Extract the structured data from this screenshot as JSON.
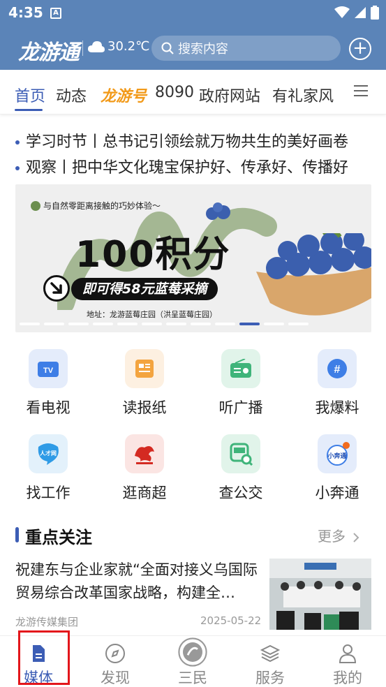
{
  "status_bar": {
    "time": "4:35",
    "notification_icon": "A"
  },
  "header": {
    "logo": "龙游通",
    "weather": {
      "icon": "cloud-icon",
      "temperature": "30.2℃"
    },
    "search": {
      "placeholder": "搜索内容"
    },
    "add_icon": "plus-icon"
  },
  "tabs": [
    {
      "label": "首页",
      "active": true
    },
    {
      "label": "动态"
    },
    {
      "label": "龙游号"
    },
    {
      "label": "8090"
    },
    {
      "label": "政府网站"
    },
    {
      "label": "有礼家风"
    }
  ],
  "headlines": [
    "学习时节丨总书记引领绘就万物共生的美好画卷",
    "观察丨把中华文化瑰宝保护好、传承好、传播好"
  ],
  "banner": {
    "tagline": "与自然零距离接触的巧妙体验～",
    "headline": "100积分",
    "subline": "即可得58元蓝莓采摘",
    "address": "地址：龙游蓝莓庄园（洪呈蓝莓庄园）",
    "slide_count": 12,
    "active_slide": 10
  },
  "services": [
    {
      "label": "看电视",
      "icon": "tv-icon",
      "badge": "TV"
    },
    {
      "label": "读报纸",
      "icon": "newspaper-icon",
      "badge": ""
    },
    {
      "label": "听广播",
      "icon": "radio-icon",
      "badge": ""
    },
    {
      "label": "我爆料",
      "icon": "hashtag-icon",
      "badge": "#"
    },
    {
      "label": "找工作",
      "icon": "job-icon",
      "badge": "人才网"
    },
    {
      "label": "逛商超",
      "icon": "dragon-shop-icon",
      "badge": ""
    },
    {
      "label": "查公交",
      "icon": "bus-icon",
      "badge": ""
    },
    {
      "label": "小奔通",
      "icon": "xiaobentong-icon",
      "badge": "小奔通"
    }
  ],
  "focus": {
    "title": "重点关注",
    "more": "更多",
    "article": {
      "title": "祝建东与企业家就“全面对接义乌国际贸易综合改革国家战略，构建全…",
      "source": "龙游传媒集团",
      "date": "2025-05-22"
    }
  },
  "bottom_nav": [
    {
      "label": "媒体",
      "icon": "document-icon",
      "active": true
    },
    {
      "label": "发现",
      "icon": "compass-icon"
    },
    {
      "label": "三民",
      "icon": "sanmin-icon"
    },
    {
      "label": "服务",
      "icon": "layers-icon"
    },
    {
      "label": "我的",
      "icon": "user-icon"
    }
  ],
  "colors": {
    "header_bg": "#5b84b8",
    "accent": "#3c5db5",
    "brand_orange": "#f29a1a",
    "highlight": "#e3161b"
  }
}
